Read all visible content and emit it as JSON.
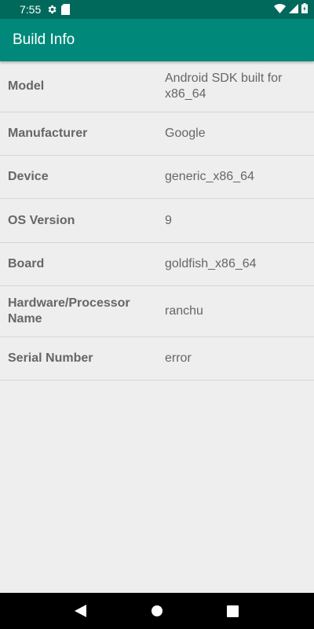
{
  "status_bar": {
    "time": "7:55",
    "icons": [
      "gear-icon",
      "sd-card-icon",
      "wifi-icon",
      "signal-icon",
      "battery-icon"
    ]
  },
  "app_bar": {
    "title": "Build Info"
  },
  "rows": [
    {
      "label": "Model",
      "value": "Android SDK built for x86_64"
    },
    {
      "label": "Manufacturer",
      "value": "Google"
    },
    {
      "label": "Device",
      "value": "generic_x86_64"
    },
    {
      "label": "OS Version",
      "value": "9"
    },
    {
      "label": "Board",
      "value": "goldfish_x86_64"
    },
    {
      "label": "Hardware/Processor Name",
      "value": "ranchu"
    },
    {
      "label": "Serial Number",
      "value": "error"
    }
  ],
  "nav_bar": {
    "icons": [
      "back-icon",
      "home-icon",
      "recents-icon"
    ]
  },
  "colors": {
    "status_bar": "#00695C",
    "app_bar": "#00897B",
    "background": "#EEEEEE",
    "text": "#666666"
  }
}
